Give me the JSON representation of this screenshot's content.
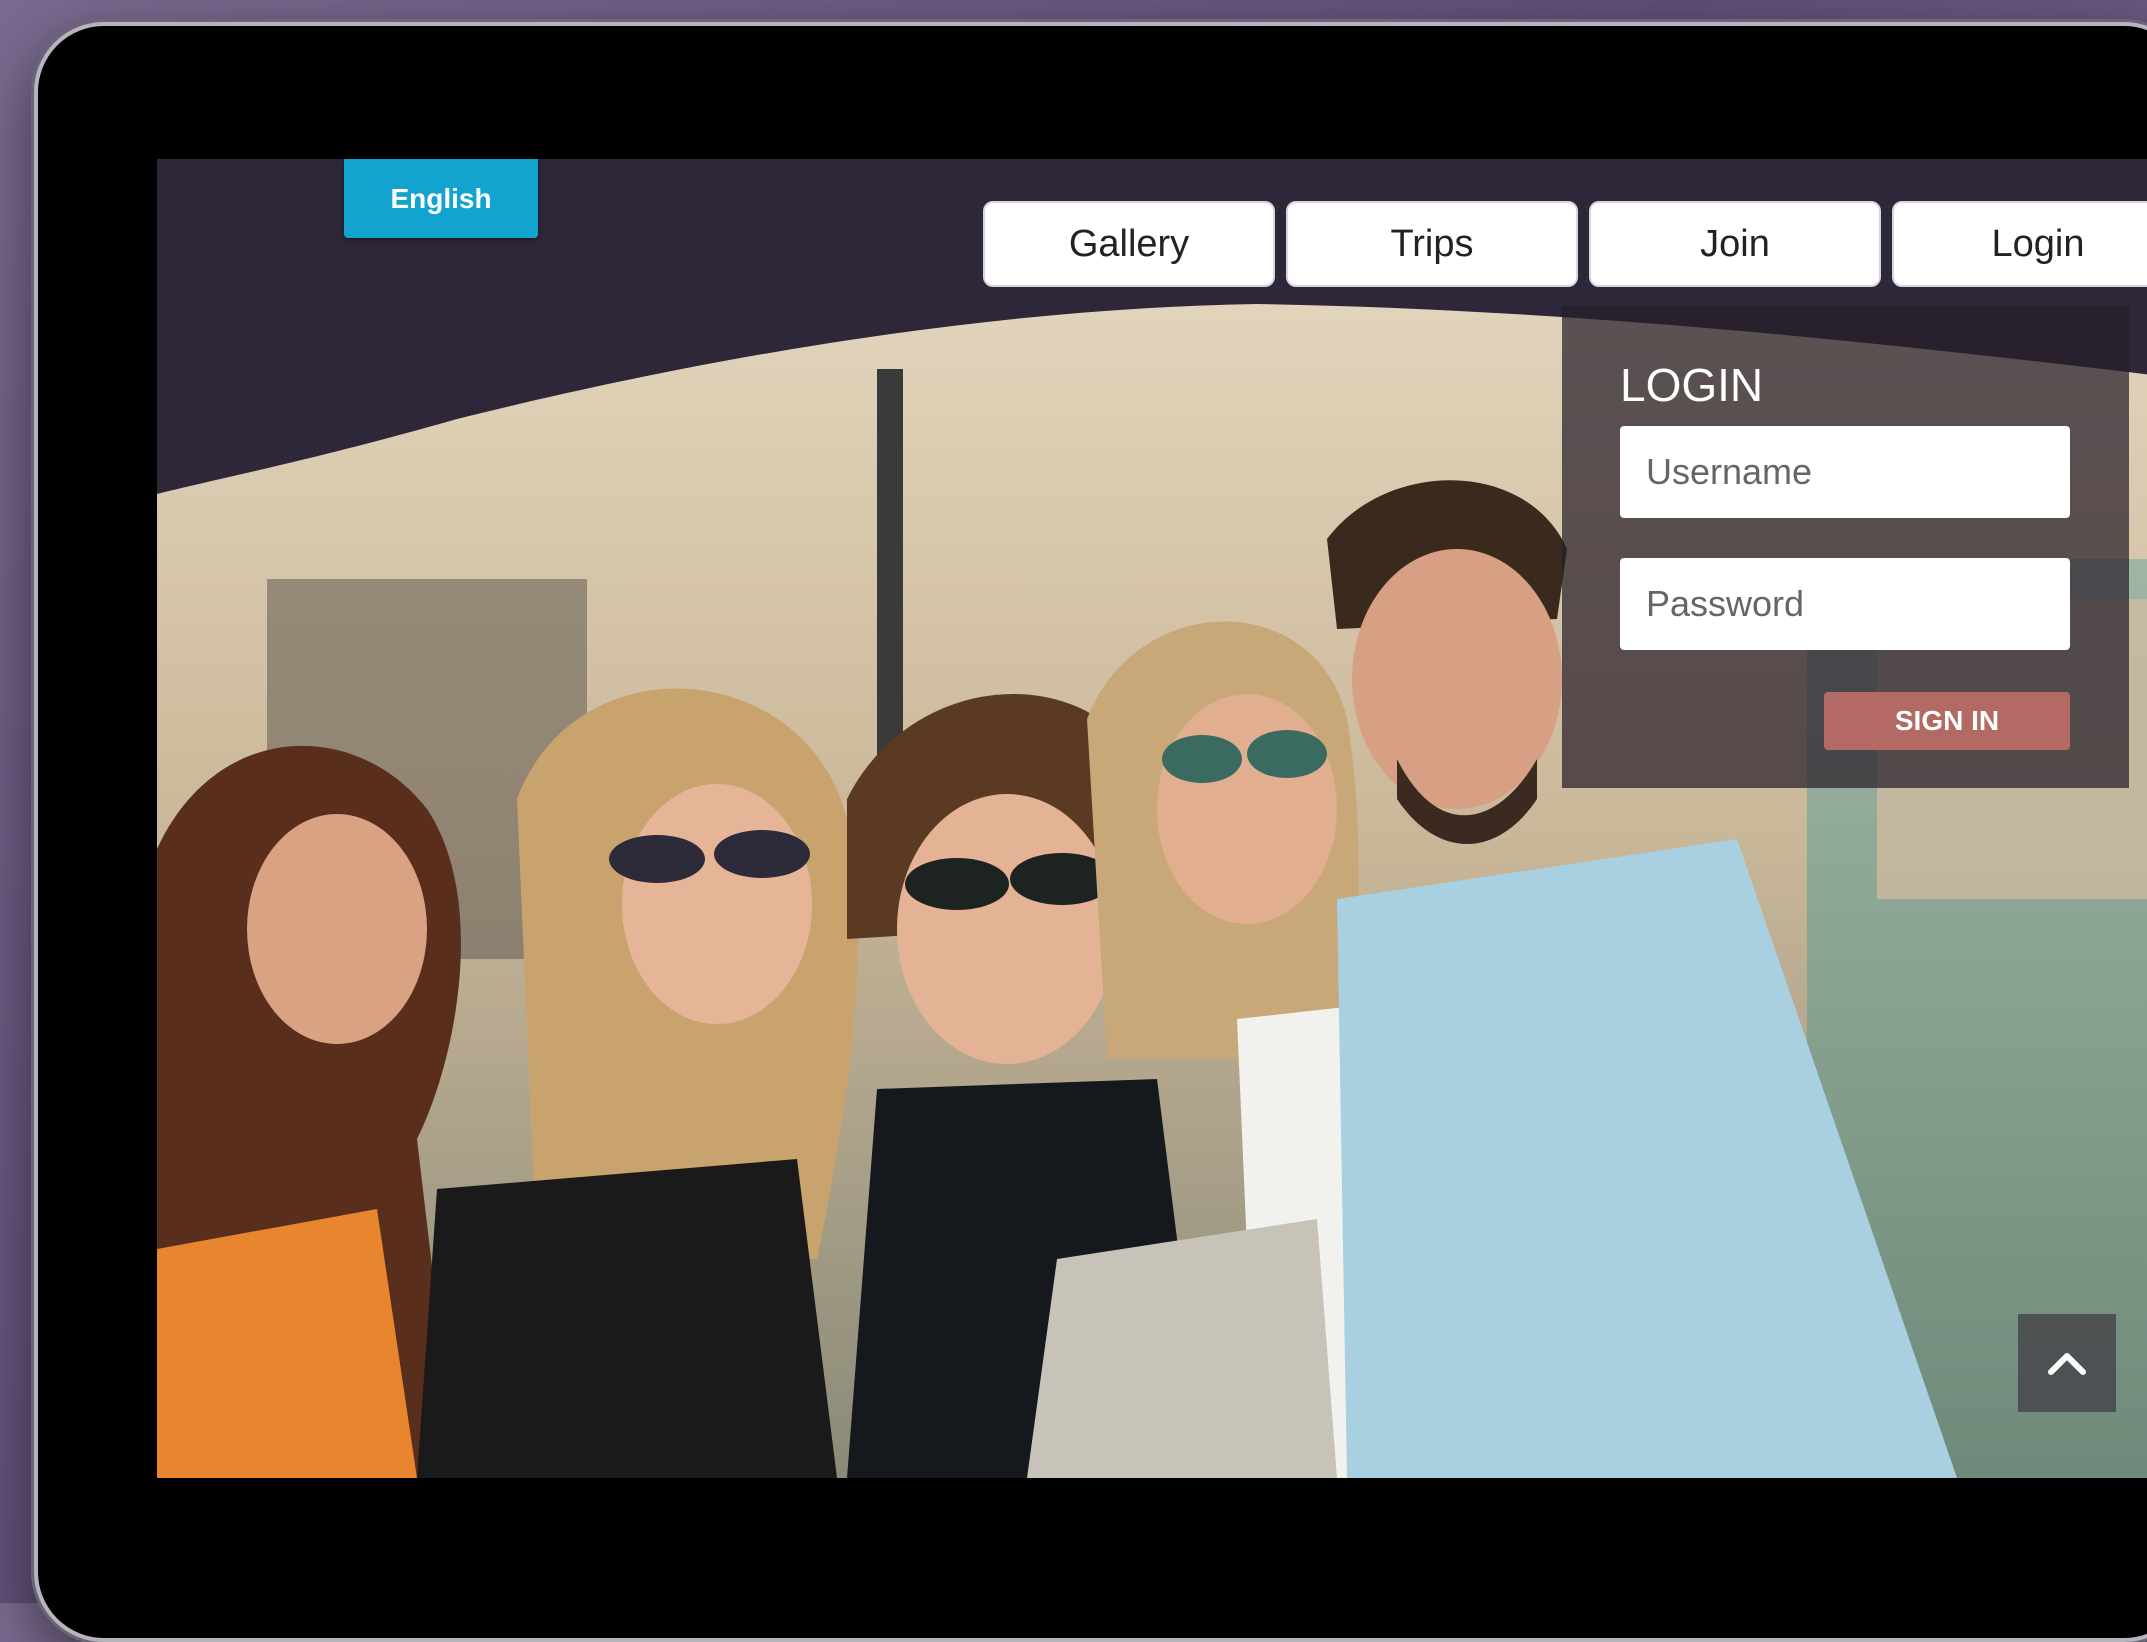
{
  "language": {
    "label": "English"
  },
  "nav": {
    "items": [
      {
        "label": "Gallery"
      },
      {
        "label": "Trips"
      },
      {
        "label": "Join"
      },
      {
        "label": "Login"
      }
    ]
  },
  "login": {
    "title": "LOGIN",
    "username_placeholder": "Username",
    "password_placeholder": "Password",
    "submit_label": "SIGN IN"
  },
  "icons": {
    "scroll_top": "chevron-up-icon"
  },
  "colors": {
    "header_bg": "#2e2639",
    "language_button": "#13a3cf",
    "signin_button": "#b36a65"
  }
}
